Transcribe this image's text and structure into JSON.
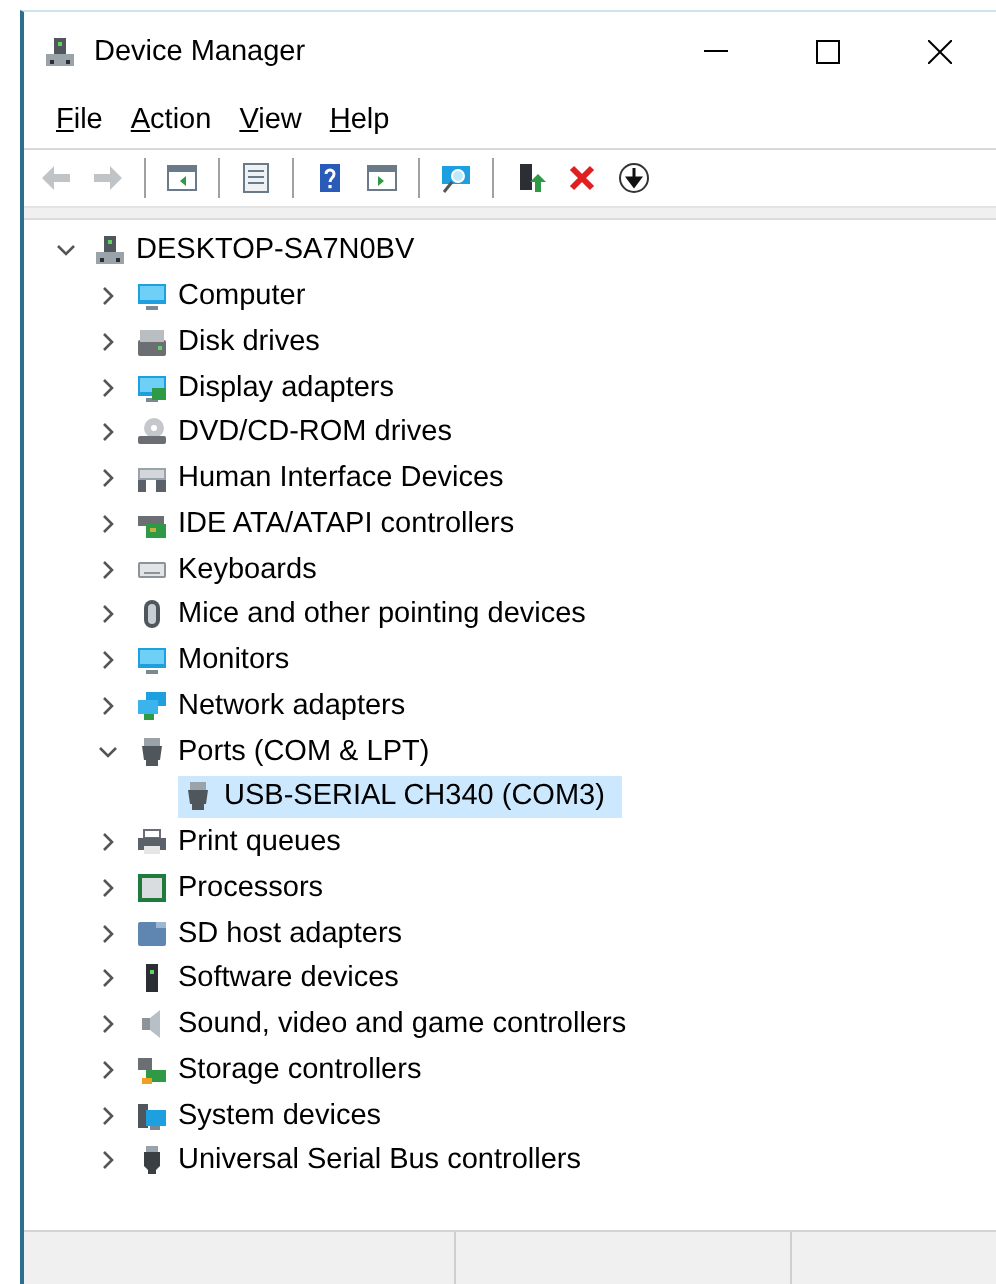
{
  "window": {
    "title": "Device Manager"
  },
  "menu": [
    {
      "label": "File"
    },
    {
      "label": "Action"
    },
    {
      "label": "View"
    },
    {
      "label": "Help"
    }
  ],
  "toolbar": [
    {
      "kind": "button",
      "disabled": true
    },
    {
      "kind": "button",
      "disabled": true
    },
    {
      "kind": "separator"
    },
    {
      "kind": "button",
      "disabled": false
    },
    {
      "kind": "separator"
    },
    {
      "kind": "button",
      "disabled": false
    },
    {
      "kind": "separator"
    },
    {
      "kind": "button",
      "disabled": false
    },
    {
      "kind": "button",
      "disabled": false
    },
    {
      "kind": "separator"
    },
    {
      "kind": "button",
      "disabled": false
    },
    {
      "kind": "separator"
    },
    {
      "kind": "button",
      "disabled": false
    },
    {
      "kind": "button",
      "disabled": false
    },
    {
      "kind": "button",
      "disabled": false
    }
  ],
  "tree": {
    "label": "DESKTOP-SA7N0BV",
    "expanded": true,
    "selected": false,
    "children": [
      {
        "label": "Computer",
        "expanded": false,
        "selected": false
      },
      {
        "label": "Disk drives",
        "expanded": false,
        "selected": false
      },
      {
        "label": "Display adapters",
        "expanded": false,
        "selected": false
      },
      {
        "label": "DVD/CD-ROM drives",
        "expanded": false,
        "selected": false
      },
      {
        "label": "Human Interface Devices",
        "expanded": false,
        "selected": false
      },
      {
        "label": "IDE ATA/ATAPI controllers",
        "expanded": false,
        "selected": false
      },
      {
        "label": "Keyboards",
        "expanded": false,
        "selected": false
      },
      {
        "label": "Mice and other pointing devices",
        "expanded": false,
        "selected": false
      },
      {
        "label": "Monitors",
        "expanded": false,
        "selected": false
      },
      {
        "label": "Network adapters",
        "expanded": false,
        "selected": false
      },
      {
        "label": "Ports (COM & LPT)",
        "expanded": true,
        "selected": false,
        "children": [
          {
            "label": "USB-SERIAL CH340 (COM3)",
            "selected": true
          }
        ]
      },
      {
        "label": "Print queues",
        "expanded": false,
        "selected": false
      },
      {
        "label": "Processors",
        "expanded": false,
        "selected": false
      },
      {
        "label": "SD host adapters",
        "expanded": false,
        "selected": false
      },
      {
        "label": "Software devices",
        "expanded": false,
        "selected": false
      },
      {
        "label": "Sound, video and game controllers",
        "expanded": false,
        "selected": false
      },
      {
        "label": "Storage controllers",
        "expanded": false,
        "selected": false
      },
      {
        "label": "System devices",
        "expanded": false,
        "selected": false
      },
      {
        "label": "Universal Serial Bus controllers",
        "expanded": false,
        "selected": false
      }
    ]
  }
}
